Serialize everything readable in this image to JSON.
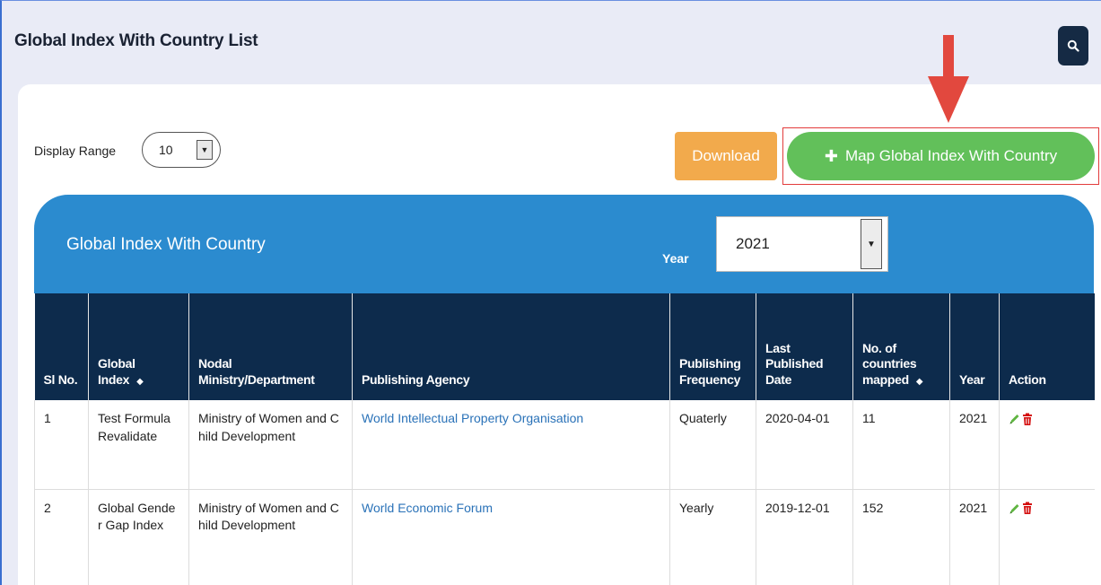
{
  "page": {
    "title": "Global Index With Country List",
    "search_icon": "search-icon"
  },
  "controls": {
    "display_range_label": "Display Range",
    "display_range_value": "10",
    "download_label": "Download",
    "map_button_label": "Map Global Index With Country",
    "map_button_icon": "plus-icon"
  },
  "panel": {
    "title": "Global Index With Country",
    "year_label": "Year",
    "year_value": "2021"
  },
  "table": {
    "headers": {
      "sl_no": "Sl No.",
      "global_index": "Global Index",
      "nodal": "Nodal Ministry/Department",
      "agency": "Publishing Agency",
      "frequency": "Publishing Frequency",
      "last_published": "Last Published Date",
      "countries": "No. of countries mapped",
      "year": "Year",
      "action": "Action"
    },
    "rows": [
      {
        "sl": "1",
        "global_index": "Test Formula Revalidate",
        "nodal": "Ministry of Women and Child Development",
        "agency": "World Intellectual Property Organisation",
        "frequency": "Quaterly",
        "last_published": "2020-04-01",
        "countries": "11",
        "year": "2021"
      },
      {
        "sl": "2",
        "global_index": "Global Gender Gap Index",
        "nodal": "Ministry of Women and Child Development",
        "agency": "World Economic Forum",
        "frequency": "Yearly",
        "last_published": "2019-12-01",
        "countries": "152",
        "year": "2021"
      }
    ]
  },
  "colors": {
    "page_bg": "#e9ebf6",
    "panel_blue": "#2b8bcf",
    "header_navy": "#0d2b4c",
    "download_orange": "#f2aa4c",
    "map_green": "#62c05a",
    "annotation_red": "#e2483e",
    "link_blue": "#2a72b8"
  }
}
